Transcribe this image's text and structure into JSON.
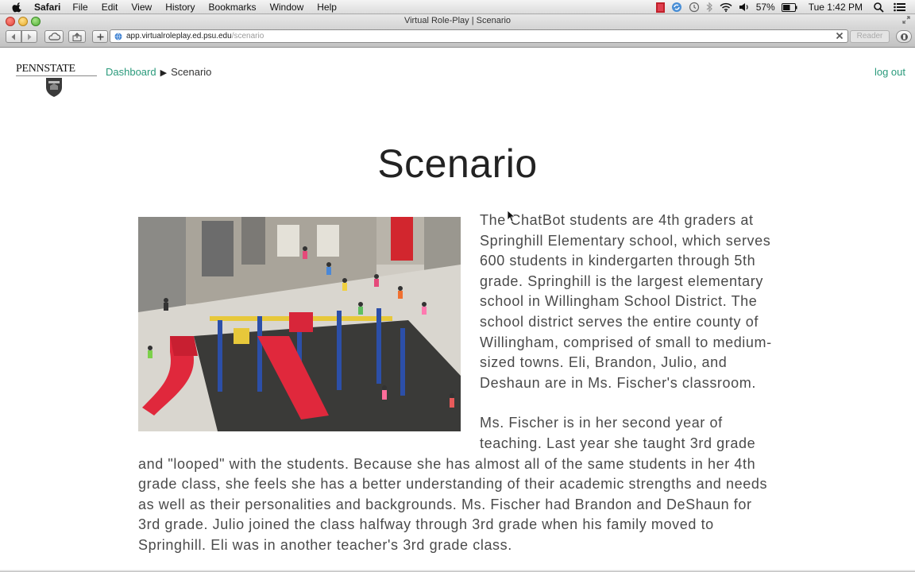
{
  "menubar": {
    "app": "Safari",
    "items": [
      "File",
      "Edit",
      "View",
      "History",
      "Bookmarks",
      "Window",
      "Help"
    ],
    "battery": "57%",
    "clock": "Tue 1:42 PM"
  },
  "window": {
    "title": "Virtual Role-Play | Scenario"
  },
  "toolbar": {
    "url_host": "app.virtualroleplay.ed.psu.edu",
    "url_path": "/scenario",
    "reader_label": "Reader"
  },
  "header": {
    "logo_text": "PENNSTATE",
    "breadcrumb": {
      "link": "Dashboard",
      "separator": "▶",
      "current": "Scenario"
    },
    "logout_label": "log out"
  },
  "main": {
    "title": "Scenario",
    "paragraphs": [
      "The ChatBot students are 4th graders at Springhill Elementary school, which serves 600 students in kindergarten through 5th grade. Springhill is the largest elementary school in Willingham School District. The school district serves the entire county of Willingham, comprised of small to medium-sized towns. Eli, Brandon, Julio, and Deshaun are in Ms. Fischer's classroom.",
      "Ms. Fischer is in her second year of teaching. Last year she taught 3rd grade and \"looped\" with the students. Because she has almost all of the same students in her 4th grade class, she feels she has a better understanding of their academic strengths and needs as well as their personalities and backgrounds. Ms. Fischer had Brandon and DeShaun for 3rd grade. Julio joined the class halfway through 3rd grade when his family moved to Springhill. Eli was in another teacher's 3rd grade class."
    ]
  },
  "colors": {
    "accent_link": "#2a9a7b",
    "body_text": "#4a4a4a"
  }
}
